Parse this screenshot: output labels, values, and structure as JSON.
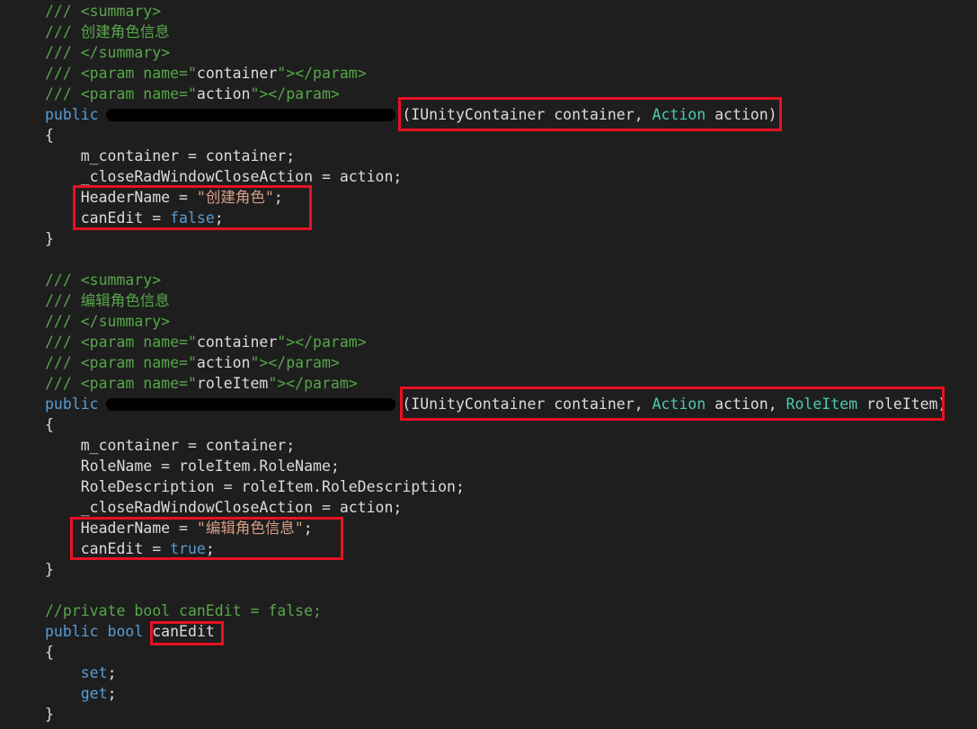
{
  "lines": [
    [
      {
        "c": "comment",
        "t": "/// <summary>"
      }
    ],
    [
      {
        "c": "comment",
        "t": "/// 创建角色信息"
      }
    ],
    [
      {
        "c": "comment",
        "t": "/// </summary>"
      }
    ],
    [
      {
        "c": "comment",
        "t": "/// <param name=\""
      },
      {
        "c": "plain",
        "t": "container"
      },
      {
        "c": "comment",
        "t": "\"></param>"
      }
    ],
    [
      {
        "c": "comment",
        "t": "/// <param name=\""
      },
      {
        "c": "plain",
        "t": "action"
      },
      {
        "c": "comment",
        "t": "\"></param>"
      }
    ],
    [
      {
        "c": "kw",
        "t": "public"
      },
      {
        "c": "plain",
        "t": "                                  "
      },
      {
        "c": "plain",
        "t": "(IUnityContainer container, "
      },
      {
        "c": "type",
        "t": "Action"
      },
      {
        "c": "plain",
        "t": " action)"
      }
    ],
    [
      {
        "c": "plain",
        "t": "{"
      }
    ],
    [
      {
        "c": "plain",
        "t": "    m_container = container;"
      }
    ],
    [
      {
        "c": "plain",
        "t": "    _closeRadWindowCloseAction = action;"
      }
    ],
    [
      {
        "c": "plain",
        "t": "    HeaderName = "
      },
      {
        "c": "str",
        "t": "\"创建角色\""
      },
      {
        "c": "plain",
        "t": ";"
      }
    ],
    [
      {
        "c": "plain",
        "t": "    canEdit = "
      },
      {
        "c": "kw",
        "t": "false"
      },
      {
        "c": "plain",
        "t": ";"
      }
    ],
    [
      {
        "c": "plain",
        "t": "}"
      }
    ],
    [
      {
        "c": "plain",
        "t": ""
      }
    ],
    [
      {
        "c": "comment",
        "t": "/// <summary>"
      }
    ],
    [
      {
        "c": "comment",
        "t": "/// 编辑角色信息"
      }
    ],
    [
      {
        "c": "comment",
        "t": "/// </summary>"
      }
    ],
    [
      {
        "c": "comment",
        "t": "/// <param name=\""
      },
      {
        "c": "plain",
        "t": "container"
      },
      {
        "c": "comment",
        "t": "\"></param>"
      }
    ],
    [
      {
        "c": "comment",
        "t": "/// <param name=\""
      },
      {
        "c": "plain",
        "t": "action"
      },
      {
        "c": "comment",
        "t": "\"></param>"
      }
    ],
    [
      {
        "c": "comment",
        "t": "/// <param name=\""
      },
      {
        "c": "plain",
        "t": "roleItem"
      },
      {
        "c": "comment",
        "t": "\"></param>"
      }
    ],
    [
      {
        "c": "kw",
        "t": "public"
      },
      {
        "c": "plain",
        "t": "                                  "
      },
      {
        "c": "plain",
        "t": "(IUnityContainer container, "
      },
      {
        "c": "type",
        "t": "Action"
      },
      {
        "c": "plain",
        "t": " action, "
      },
      {
        "c": "type",
        "t": "RoleItem"
      },
      {
        "c": "plain",
        "t": " roleItem)"
      }
    ],
    [
      {
        "c": "plain",
        "t": "{"
      }
    ],
    [
      {
        "c": "plain",
        "t": "    m_container = container;"
      }
    ],
    [
      {
        "c": "plain",
        "t": "    RoleName = roleItem.RoleName;"
      }
    ],
    [
      {
        "c": "plain",
        "t": "    RoleDescription = roleItem.RoleDescription;"
      }
    ],
    [
      {
        "c": "plain",
        "t": "    _closeRadWindowCloseAction = action;"
      }
    ],
    [
      {
        "c": "plain",
        "t": "    HeaderName = "
      },
      {
        "c": "str",
        "t": "\"编辑角色信息\""
      },
      {
        "c": "plain",
        "t": ";"
      }
    ],
    [
      {
        "c": "plain",
        "t": "    canEdit = "
      },
      {
        "c": "kw",
        "t": "true"
      },
      {
        "c": "plain",
        "t": ";"
      }
    ],
    [
      {
        "c": "plain",
        "t": "}"
      }
    ],
    [
      {
        "c": "plain",
        "t": ""
      }
    ],
    [
      {
        "c": "comment",
        "t": "//private bool canEdit = false;"
      }
    ],
    [
      {
        "c": "kw",
        "t": "public"
      },
      {
        "c": "plain",
        "t": " "
      },
      {
        "c": "kw",
        "t": "bool"
      },
      {
        "c": "plain",
        "t": " canEdit"
      }
    ],
    [
      {
        "c": "plain",
        "t": "{"
      }
    ],
    [
      {
        "c": "plain",
        "t": "    "
      },
      {
        "c": "kw",
        "t": "set"
      },
      {
        "c": "plain",
        "t": ";"
      }
    ],
    [
      {
        "c": "plain",
        "t": "    "
      },
      {
        "c": "kw",
        "t": "get"
      },
      {
        "c": "plain",
        "t": ";"
      }
    ],
    [
      {
        "c": "plain",
        "t": "}"
      }
    ]
  ],
  "colors": {
    "background": "#1e1e1e",
    "comment": "#57a64a",
    "keyword": "#569cd6",
    "type": "#4ec9b0",
    "string": "#d69d85",
    "text": "#dcdcdc",
    "highlight_box": "#e81123",
    "redaction": "#000000"
  }
}
